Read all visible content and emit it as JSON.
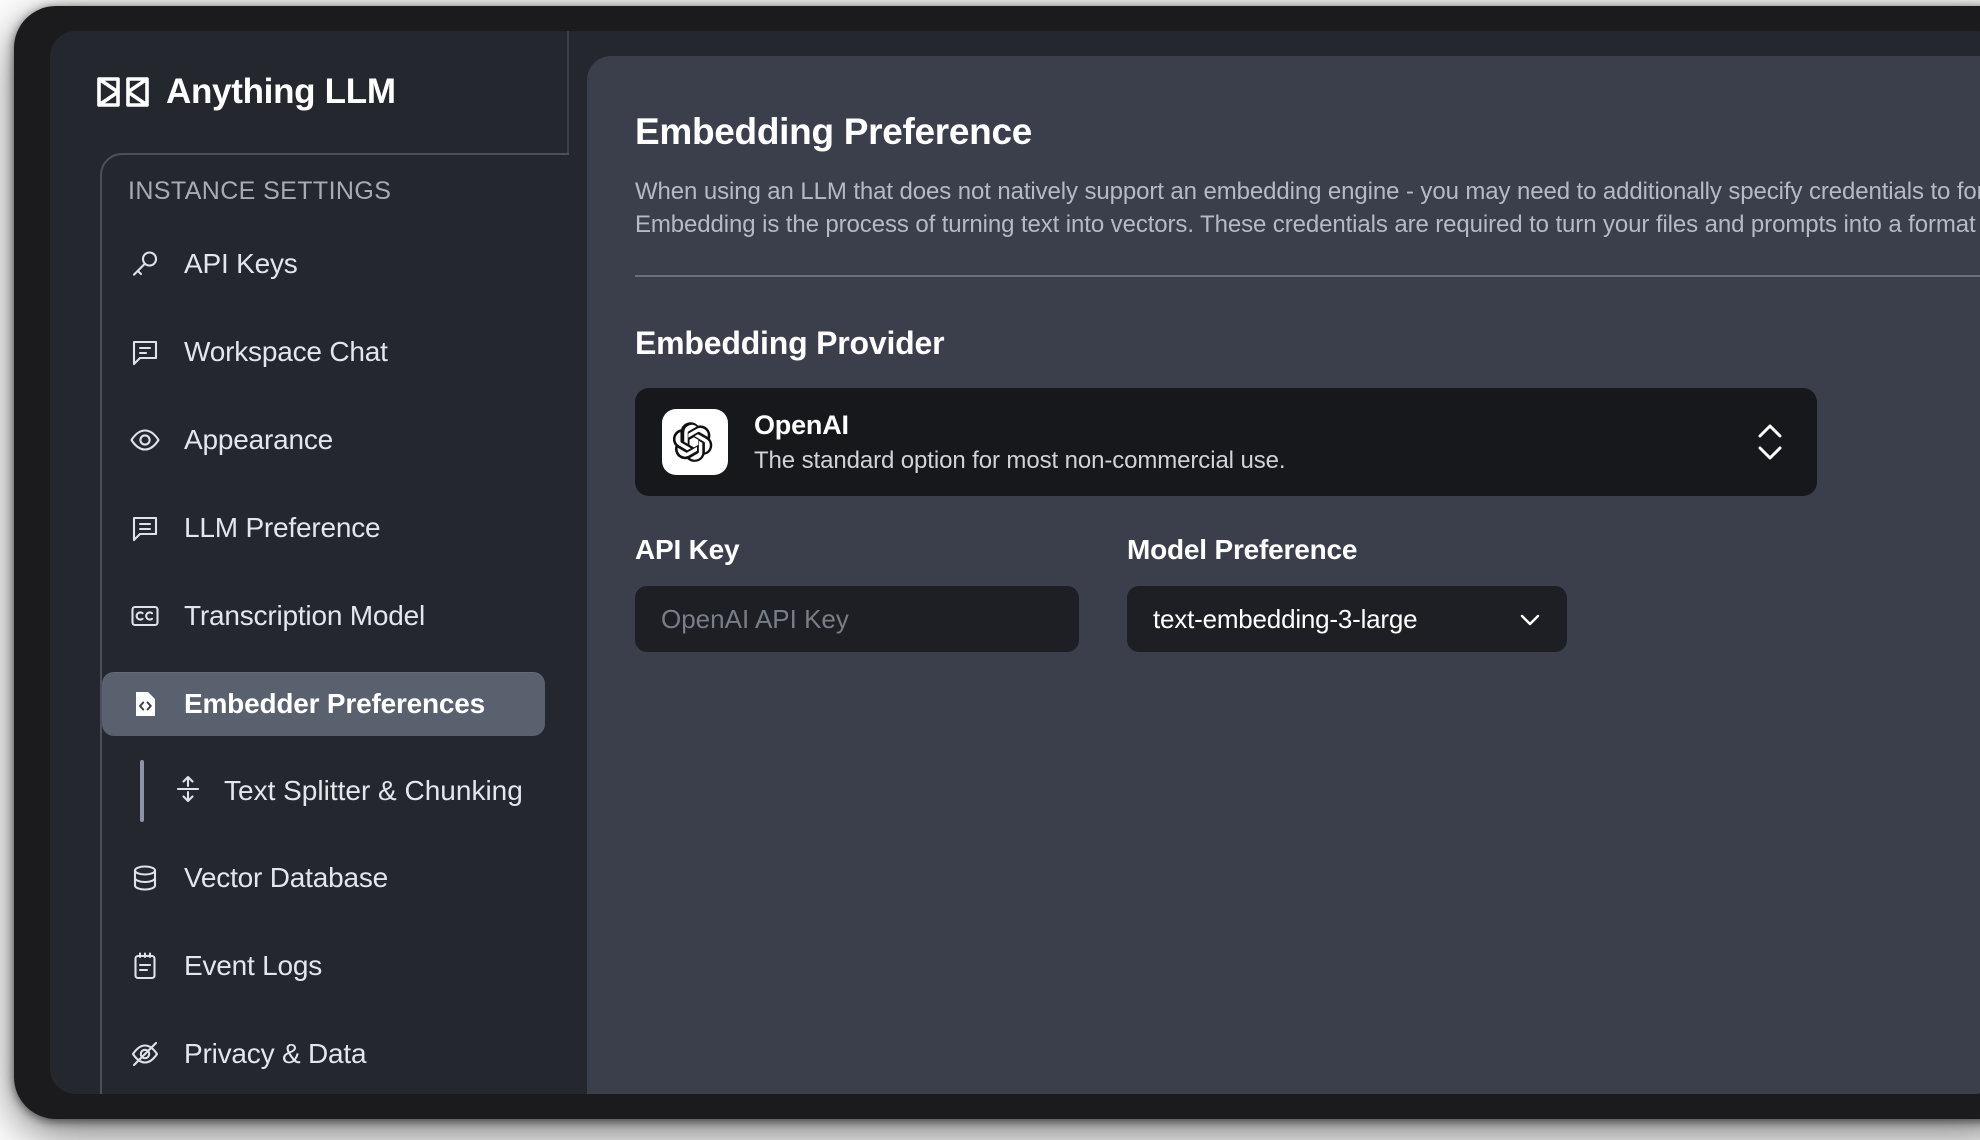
{
  "brand": {
    "name": "Anything LLM",
    "logo_icon": "anythingllm-logo-icon"
  },
  "sidebar": {
    "section_title": "INSTANCE SETTINGS",
    "items": [
      {
        "label": "API Keys",
        "icon": "key-icon",
        "active": false
      },
      {
        "label": "Workspace Chat",
        "icon": "chat-bubble-icon",
        "active": false
      },
      {
        "label": "Appearance",
        "icon": "eye-icon",
        "active": false
      },
      {
        "label": "LLM Preference",
        "icon": "chat-bubble-lines-icon",
        "active": false
      },
      {
        "label": "Transcription Model",
        "icon": "closed-caption-icon",
        "active": false
      },
      {
        "label": "Embedder Preferences",
        "icon": "file-code-icon",
        "active": true
      }
    ],
    "sub_item": {
      "label": "Text Splitter & Chunking",
      "icon": "split-vertical-icon"
    },
    "items_after": [
      {
        "label": "Vector Database",
        "icon": "database-icon",
        "active": false
      },
      {
        "label": "Event Logs",
        "icon": "notepad-icon",
        "active": false
      },
      {
        "label": "Privacy & Data",
        "icon": "eye-slash-icon",
        "active": false
      }
    ]
  },
  "main": {
    "title": "Embedding Preference",
    "description_line1": "When using an LLM that does not natively support an embedding engine - you may need to additionally specify credentials to for en",
    "description_line2": "Embedding is the process of turning text into vectors. These credentials are required to turn your files and prompts into a format whi",
    "section_title": "Embedding Provider",
    "provider": {
      "name": "OpenAI",
      "description": "The standard option for most non-commercial use.",
      "logo_icon": "openai-logo-icon",
      "caret_icon": "caret-up-down-icon"
    },
    "api_key": {
      "label": "API Key",
      "value": "",
      "placeholder": "OpenAI API Key"
    },
    "model_preference": {
      "label": "Model Preference",
      "selected": "text-embedding-3-large",
      "caret_icon": "chevron-down-icon"
    }
  },
  "colors": {
    "window_bg": "#24272e",
    "main_bg": "#3a3f4b",
    "active_item": "#5a616e",
    "input_bg": "#1d1f24",
    "card_bg": "#16181c"
  }
}
